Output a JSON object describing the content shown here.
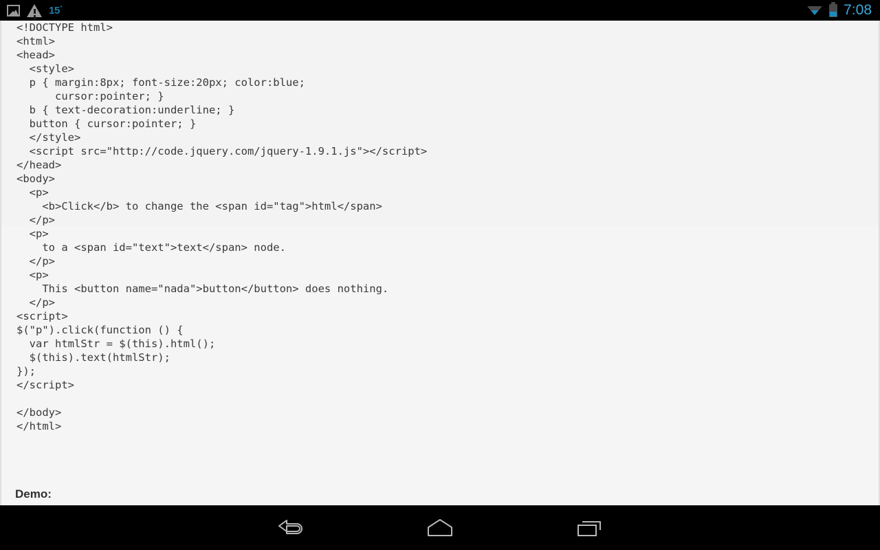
{
  "status_bar": {
    "left_icons": [
      {
        "name": "screenshot-image-icon",
        "label": "screenshot"
      },
      {
        "name": "warning-triangle-icon",
        "label": "warning"
      }
    ],
    "temperature": "15",
    "temperature_unit": "°",
    "right_icons": [
      {
        "name": "wifi-icon",
        "label": "wifi"
      },
      {
        "name": "battery-icon",
        "label": "battery"
      }
    ],
    "clock": "7:08",
    "accent_color": "#3aa8da",
    "temp_color": "#1c7ca5",
    "background_color": "#000000"
  },
  "webview": {
    "background_color": "#f3f3f3",
    "code_color": "#3a3a3a",
    "code_listing": "<!DOCTYPE html>\n<html>\n<head>\n  <style>\n  p { margin:8px; font-size:20px; color:blue;\n      cursor:pointer; }\n  b { text-decoration:underline; }\n  button { cursor:pointer; }\n  </style>\n  <script src=\"http://code.jquery.com/jquery-1.9.1.js\"></script>\n</head>\n<body>\n  <p>\n    <b>Click</b> to change the <span id=\"tag\">html</span>\n  </p>\n  <p>\n    to a <span id=\"text\">text</span> node.\n  </p>\n  <p>\n    This <button name=\"nada\">button</button> does nothing.\n  </p>\n<script>\n$(\"p\").click(function () {\n  var htmlStr = $(this).html();\n  $(this).text(htmlStr);\n});\n</script>\n\n</body>\n</html>",
    "demo_heading": "Demo:"
  },
  "nav_bar": {
    "background_color": "#000000",
    "icon_color": "#b8b8b8",
    "buttons": [
      {
        "name": "back-icon",
        "label": "Back"
      },
      {
        "name": "home-icon",
        "label": "Home"
      },
      {
        "name": "recent-apps-icon",
        "label": "Recent apps"
      }
    ]
  }
}
